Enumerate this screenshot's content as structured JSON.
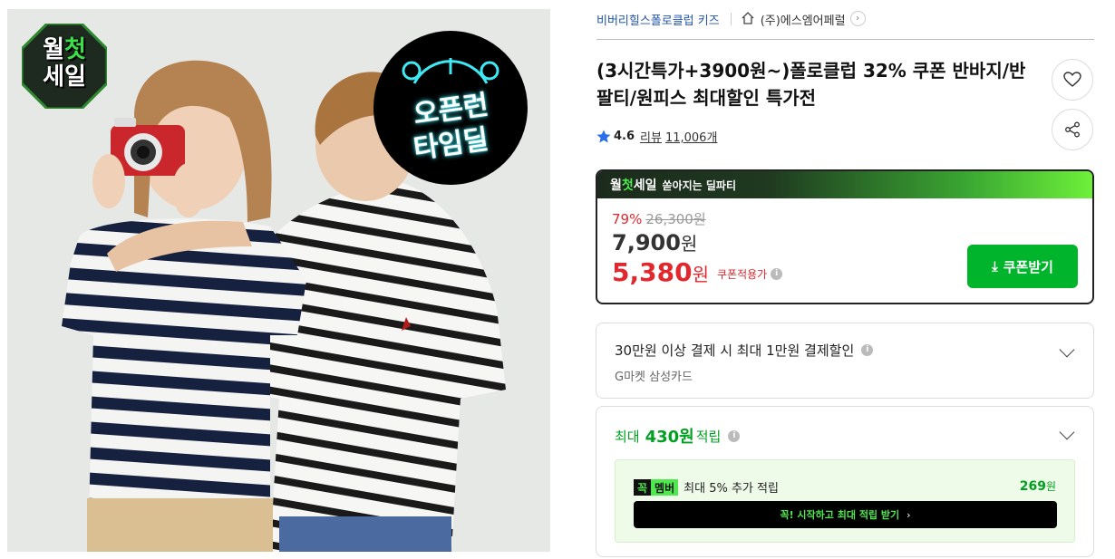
{
  "image": {
    "badge_left": {
      "prefix": "월",
      "highlight": "첫",
      "suffix": "세일"
    },
    "badge_right": {
      "line1": "오픈런",
      "line2": "타임딜"
    }
  },
  "breadcrumb": {
    "brand": "비버리힐스폴로클럽 키즈",
    "seller": "(주)에스엠어페럴",
    "home_icon": "home-icon",
    "chevron_icon": "chevron-right-icon"
  },
  "product": {
    "title": "(3시간특가+3900원~)폴로클럽 32% 쿠폰 반바지/반팔티/원피스 최대할인 특가전",
    "rating": "4.6",
    "review_label": "리뷰",
    "review_count": "11,006개"
  },
  "actions": {
    "wishlist_icon": "heart-icon",
    "share_icon": "share-icon"
  },
  "deal": {
    "logo_prefix": "월",
    "logo_highlight": "첫",
    "logo_suffix": "세일",
    "subtitle": "쏟아지는 딜파티",
    "discount_rate": "79%",
    "original_price": "26,300원",
    "sale_price": "7,900",
    "coupon_price": "5,380",
    "currency": "원",
    "coupon_label": "쿠폰적용가",
    "coupon_button": "쿠폰받기"
  },
  "card_discount": {
    "title": "30만원 이상 결제 시 최대 1만원 결제할인",
    "card": "G마켓 삼성카드"
  },
  "points": {
    "prefix": "최대",
    "amount": "430원",
    "suffix": "적립",
    "member_badge_a": "꼭",
    "member_badge_b": "멤버",
    "member_text": "최대 5% 추가 적립",
    "member_amount": "269",
    "member_currency": "원",
    "member_button": "꼭! 시작하고 최대 적립 받기"
  },
  "colors": {
    "accent_green": "#00b42b",
    "sale_red": "#e0282e",
    "brand_blue": "#2255aa",
    "member_green": "#4fe84f"
  }
}
